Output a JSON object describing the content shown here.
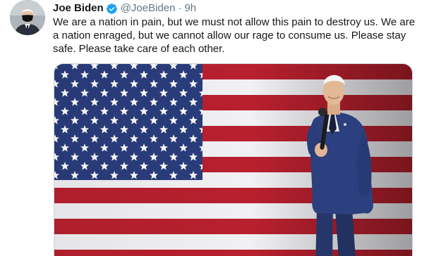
{
  "tweet": {
    "display_name": "Joe Biden",
    "handle": "@JoeBiden",
    "separator": "·",
    "time": "9h",
    "text": "We are a nation in pain, but we must not allow this pain to destroy us. We are a nation enraged, but we cannot allow our rage to consume us. Please stay safe. Please take care of each other.",
    "avatar_icon": "profile-photo",
    "verified_icon": "verified-badge-icon",
    "media_icon": "photo-speaker-with-flag"
  },
  "colors": {
    "name": "#14171a",
    "secondary": "#657786",
    "verified": "#1da1f2",
    "flag_blue": "#2a3d7c",
    "flag_red": "#b8202e",
    "flag_white": "#f1f1f4"
  }
}
